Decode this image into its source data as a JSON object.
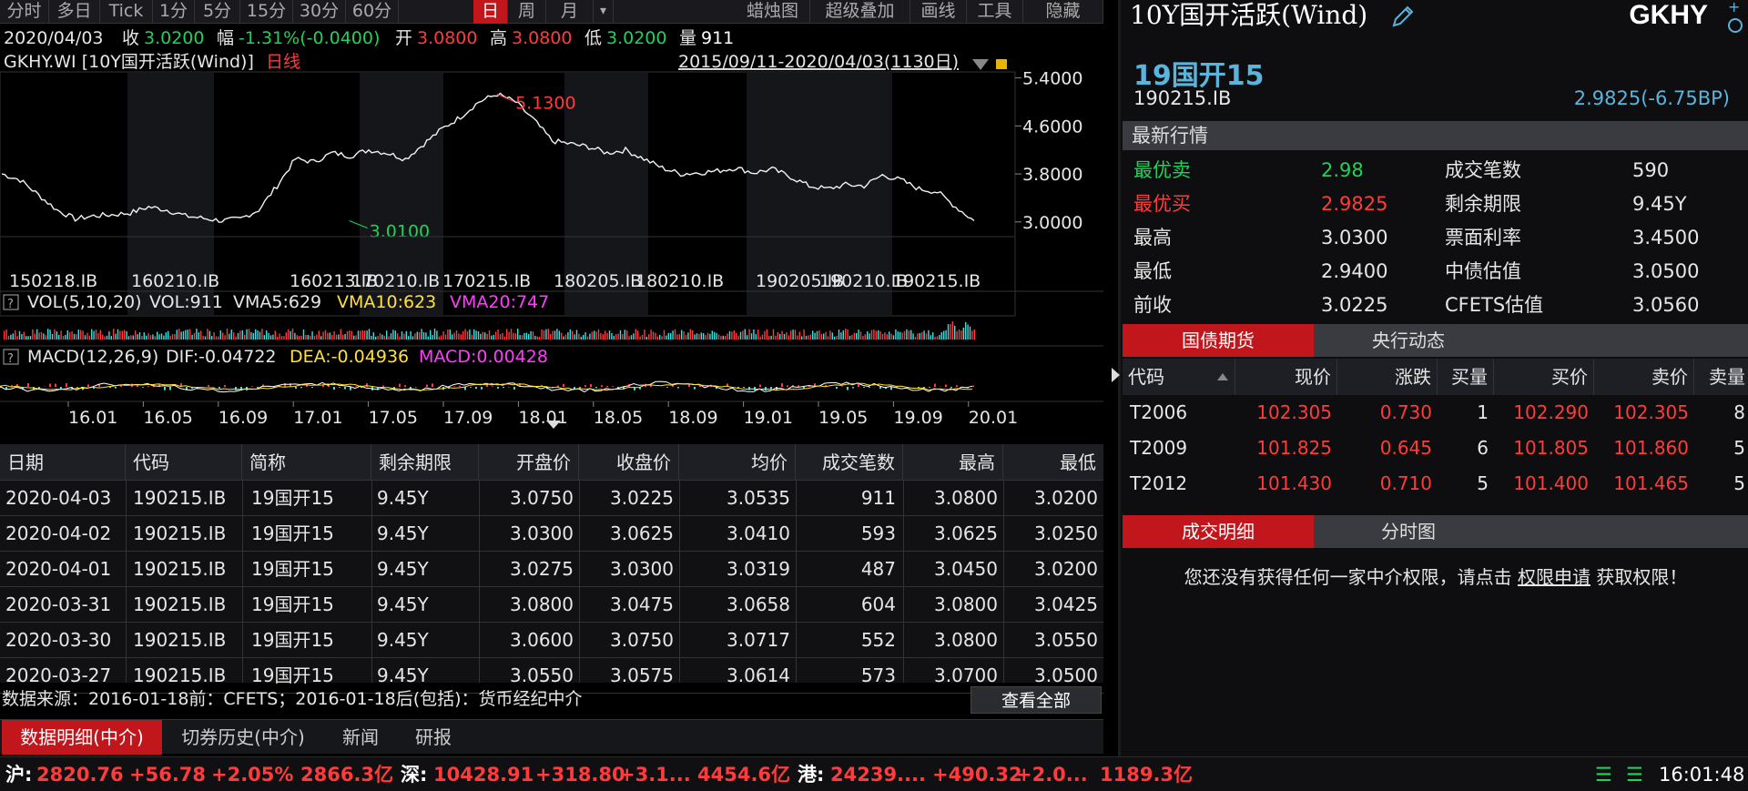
{
  "toolbar": {
    "periods": [
      "分时",
      "多日",
      "Tick",
      "1分",
      "5分",
      "15分",
      "30分",
      "60分",
      "日",
      "周",
      "月"
    ],
    "active_period": "日",
    "dropdown": "▾",
    "tools": [
      "蜡烛图",
      "超级叠加",
      "画线",
      "工具",
      "隐藏"
    ]
  },
  "quote": {
    "date": "2020/04/03",
    "close_label": "收",
    "close": "3.0200",
    "change_label": "幅",
    "change": "-1.31%(-0.0400)",
    "open_label": "开",
    "open": "3.0800",
    "high_label": "高",
    "high": "3.0800",
    "low_label": "低",
    "low": "3.0200",
    "vol_label": "量",
    "vol": "911"
  },
  "chart_header": {
    "symbol": "GKHY.WI [10Y国开活跃(Wind)]",
    "period": "日线",
    "range": "2015/09/11-2020/04/03(1130日)"
  },
  "chart_data": {
    "type": "line",
    "y_ticks": [
      "5.4000",
      "4.6000",
      "3.8000",
      "3.0000"
    ],
    "ylim": [
      2.8,
      5.5
    ],
    "max_label": "5.1300",
    "min_label": "3.0100",
    "contract_labels": [
      "150218.IB",
      "160210.IB",
      "160213.IB",
      "170210.IB",
      "170215.IB",
      "180205.IB",
      "180210.IB",
      "190205.IB",
      "190210.IB",
      "190215.IB"
    ],
    "x_ticks": [
      "16.01",
      "16.05",
      "16.09",
      "17.01",
      "17.05",
      "17.09",
      "18.01",
      "18.05",
      "18.09",
      "19.01",
      "19.05",
      "19.09",
      "20.01"
    ],
    "series": [
      {
        "values": [
          3.8,
          3.7,
          3.45,
          3.2,
          3.05,
          3.1,
          3.12,
          3.15,
          3.25,
          3.2,
          3.1,
          3.06,
          3.02,
          3.05,
          3.2,
          3.6,
          4.05,
          4.0,
          4.15,
          4.1,
          4.2,
          4.15,
          4.05,
          4.3,
          4.55,
          4.75,
          5.0,
          5.13,
          5.0,
          4.7,
          4.35,
          4.3,
          4.25,
          4.15,
          4.2,
          4.05,
          3.9,
          3.8,
          3.82,
          3.85,
          3.9,
          3.82,
          3.88,
          3.75,
          3.6,
          3.55,
          3.62,
          3.6,
          3.78,
          3.7,
          3.55,
          3.5,
          3.25,
          3.02
        ]
      }
    ],
    "vol_indicator": {
      "name": "VOL(5,10,20)",
      "vol": "VOL:911",
      "vma5": "VMA5:629",
      "vma10": "VMA10:623",
      "vma20": "VMA20:747"
    },
    "macd_indicator": {
      "name": "MACD(12,26,9)",
      "dif": "DIF:-0.04722",
      "dea": "DEA:-0.04936",
      "macd": "MACD:0.00428"
    }
  },
  "table": {
    "headers": [
      "日期",
      "代码",
      "简称",
      "剩余期限",
      "开盘价",
      "收盘价",
      "均价",
      "成交笔数",
      "最高",
      "最低"
    ],
    "rows": [
      [
        "2020-04-03",
        "190215.IB",
        "19国开15",
        "9.45Y",
        "3.0750",
        "3.0225",
        "3.0535",
        "911",
        "3.0800",
        "3.0200"
      ],
      [
        "2020-04-02",
        "190215.IB",
        "19国开15",
        "9.45Y",
        "3.0300",
        "3.0625",
        "3.0410",
        "593",
        "3.0625",
        "3.0250"
      ],
      [
        "2020-04-01",
        "190215.IB",
        "19国开15",
        "9.45Y",
        "3.0275",
        "3.0300",
        "3.0319",
        "487",
        "3.0450",
        "3.0200"
      ],
      [
        "2020-03-31",
        "190215.IB",
        "19国开15",
        "9.45Y",
        "3.0800",
        "3.0475",
        "3.0658",
        "604",
        "3.0800",
        "3.0425"
      ],
      [
        "2020-03-30",
        "190215.IB",
        "19国开15",
        "9.45Y",
        "3.0600",
        "3.0750",
        "3.0717",
        "552",
        "3.0800",
        "3.0550"
      ],
      [
        "2020-03-27",
        "190215.IB",
        "19国开15",
        "9.45Y",
        "3.0550",
        "3.0575",
        "3.0614",
        "573",
        "3.0700",
        "3.0500"
      ]
    ]
  },
  "source_note": "数据来源：2016-01-18前：CFETS；2016-01-18后(包括)：货币经纪中介",
  "view_all": "查看全部",
  "bottom_tabs": [
    "数据明细(中介)",
    "切券历史(中介)",
    "新闻",
    "研报"
  ],
  "right": {
    "title": "10Y国开活跃(Wind)",
    "code": "GKHY",
    "bond_name": "19国开15",
    "bond_code": "190215.IB",
    "bond_yield": "2.9825(-6.75BP)",
    "latest_header": "最新行情",
    "quotes": [
      {
        "k1": "最优卖",
        "v1": "2.98",
        "k2": "成交笔数",
        "v2": "590"
      },
      {
        "k1": "最优买",
        "v1": "2.9825",
        "k2": "剩余期限",
        "v2": "9.45Y"
      },
      {
        "k1": "最高",
        "v1": "3.0300",
        "k2": "票面利率",
        "v2": "3.4500"
      },
      {
        "k1": "最低",
        "v1": "2.9400",
        "k2": "中债估值",
        "v2": "3.0500"
      },
      {
        "k1": "前收",
        "v1": "3.0225",
        "k2": "CFETS估值",
        "v2": "3.0560"
      }
    ],
    "tabs1": [
      "国债期货",
      "央行动态"
    ],
    "fut_headers": [
      "代码",
      "现价",
      "涨跌",
      "买量",
      "买价",
      "卖价",
      "卖量"
    ],
    "futures": [
      [
        "T2006",
        "102.305",
        "0.730",
        "1",
        "102.290",
        "102.305",
        "8"
      ],
      [
        "T2009",
        "101.825",
        "0.645",
        "6",
        "101.805",
        "101.860",
        "5"
      ],
      [
        "T2012",
        "101.430",
        "0.710",
        "5",
        "101.400",
        "101.465",
        "5"
      ]
    ],
    "tabs2": [
      "成交明细",
      "分时图"
    ],
    "perm_pre": "您还没有获得任何一家中介权限，请点击",
    "perm_link": "权限申请",
    "perm_post": "获取权限！"
  },
  "status": {
    "sh_label": "沪:",
    "sh": "2820.76",
    "sh_chg": "+56.78",
    "sh_pct": "+2.05%",
    "sh_amt": "2866.3亿",
    "sz_label": "深:",
    "sz": "10428.91",
    "sz_chg": "+318.80",
    "sz_pct": "+3.1...",
    "sz_amt": "4454.6亿",
    "hk_label": "港:",
    "hk": "24239....",
    "hk_chg": "+490.32",
    "hk_pct": "+2.0...",
    "hk_amt": "1189.3亿",
    "time": "16:01:48"
  }
}
